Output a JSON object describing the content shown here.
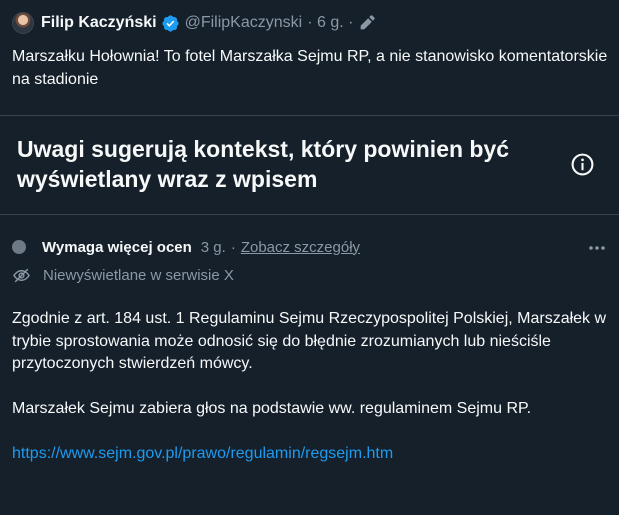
{
  "tweet": {
    "author_name": "Filip Kaczyński",
    "handle": "@FilipKaczynski",
    "meta_suffix": "· 6 g. ·",
    "text": "Marszałku Hołownia! To fotel Marszałka Sejmu RP, a nie stanowisko komentatorskie na stadionie",
    "icons": [
      "avatar",
      "verified-badge-icon",
      "edit-icon"
    ]
  },
  "community_note": {
    "heading": "Uwagi sugerują kontekst, który powinien być wyświetlany wraz z wpisem",
    "status": "Wymaga więcej ocen",
    "age": "3 g.",
    "separator": "·",
    "details_link": "Zobacz szczegóły",
    "visibility": "Niewyświetlane w serwisie X",
    "body_paragraph_1": "Zgodnie z art. 184 ust. 1 Regulaminu Sejmu Rzeczypospolitej Polskiej, Marszałek w trybie sprostowania może odnosić się do błędnie zrozumianych lub nieściśle przytoczonych stwierdzeń mówcy.",
    "body_paragraph_2": "Marszałek Sejmu zabiera głos na podstawie ww. regulaminem Sejmu RP.",
    "source_link": "https://www.sejm.gov.pl/prawo/regulamin/regsejm.htm",
    "icons": [
      "info-icon",
      "more-icon",
      "eye-off-icon"
    ]
  },
  "colors": {
    "background": "#15202b",
    "text": "#f7f9f9",
    "muted": "#8b98a5",
    "link": "#1d9bf0",
    "divider": "#38444d",
    "verified": "#1d9bf0"
  }
}
